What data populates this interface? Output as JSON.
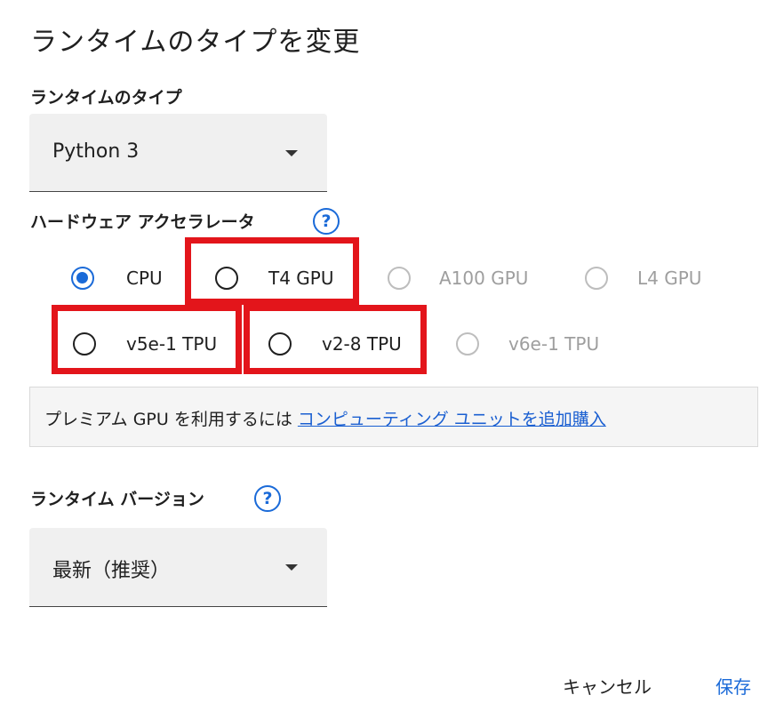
{
  "dialog": {
    "title": "ランタイムのタイプを変更",
    "runtime_type": {
      "label": "ランタイムのタイプ",
      "value": "Python 3"
    },
    "accelerator": {
      "label": "ハードウェア アクセラレータ",
      "help_icon": "question-circle-icon",
      "options": [
        {
          "label": "CPU",
          "checked": true,
          "disabled": false
        },
        {
          "label": "T4 GPU",
          "checked": false,
          "disabled": false
        },
        {
          "label": "A100 GPU",
          "checked": false,
          "disabled": true
        },
        {
          "label": "L4 GPU",
          "checked": false,
          "disabled": true
        },
        {
          "label": "v5e-1 TPU",
          "checked": false,
          "disabled": false
        },
        {
          "label": "v2-8 TPU",
          "checked": false,
          "disabled": false
        },
        {
          "label": "v6e-1 TPU",
          "checked": false,
          "disabled": true
        }
      ]
    },
    "notice": {
      "text": "プレミアム GPU を利用するには ",
      "link": "コンピューティング ユニットを追加購入"
    },
    "runtime_version": {
      "label": "ランタイム バージョン",
      "value": "最新（推奨）"
    },
    "buttons": {
      "cancel": "キャンセル",
      "save": "保存"
    },
    "colors": {
      "accent": "#1a6ad8",
      "highlight": "#e3151b",
      "disabled": "#9e9e9e"
    }
  }
}
